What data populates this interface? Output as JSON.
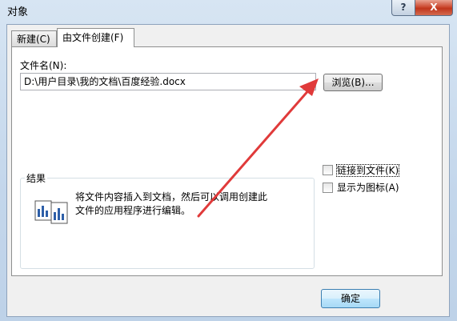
{
  "window": {
    "title": "对象",
    "help_label": "?",
    "close_label": "X"
  },
  "tabs": [
    {
      "label": "新建(C)"
    },
    {
      "label": "由文件创建(F)"
    }
  ],
  "form": {
    "filename_label": "文件名(N):",
    "filename_value": "D:\\用户目录\\我的文档\\百度经验.docx",
    "browse_label": "浏览(B)...",
    "link_label": "链接到文件(K)",
    "icon_label": "显示为图标(A)"
  },
  "result": {
    "title": "结果",
    "text": "将文件内容插入到文档，然后可以调用创建此文件的应用程序进行编辑。"
  },
  "footer": {
    "ok_label": "确定"
  },
  "colors": {
    "arrow": "#e03a3a",
    "close_button": "#c0361c"
  }
}
